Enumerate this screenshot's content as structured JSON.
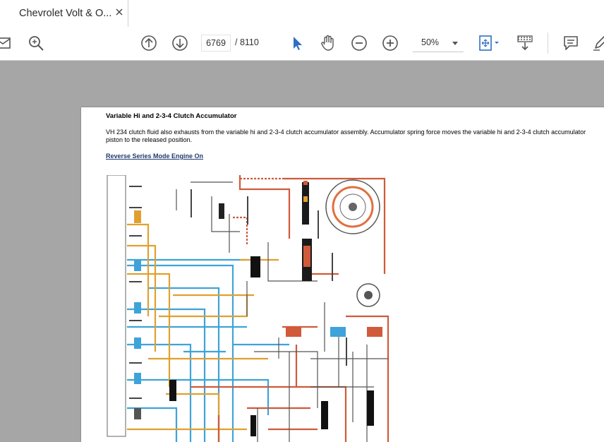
{
  "tab": {
    "title": "Chevrolet Volt & O..."
  },
  "toolbar": {
    "current_page": "6769",
    "page_separator": "/ 8110",
    "zoom": "50%"
  },
  "document": {
    "heading": "Variable Hi and 2-3-4 Clutch Accumulator",
    "body": "VH 234 clutch fluid also exhausts from the variable hi and 2-3-4 clutch accumulator assembly. Accumulator spring force moves the variable hi and 2-3-4 clutch accumulator piston to the released position.",
    "link": "Reverse Series Mode Engine On"
  },
  "colors": {
    "accent_blue": "#2f6fc4",
    "line_blue": "#3ea3d8",
    "line_orange": "#e0a030",
    "line_red": "#d05a3a"
  }
}
